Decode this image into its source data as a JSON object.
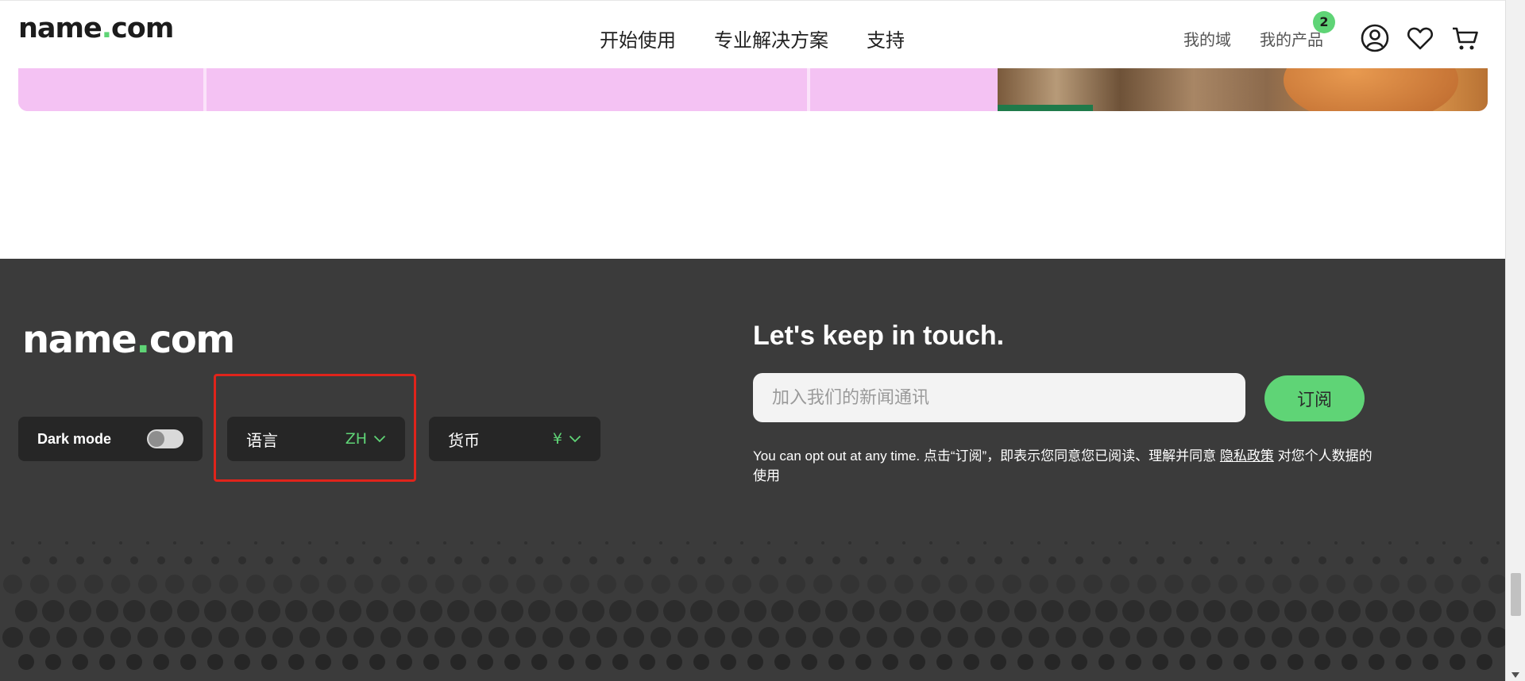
{
  "header": {
    "logo_main": "name",
    "logo_dot": ".",
    "logo_tld": "com",
    "nav": [
      "开始使用",
      "专业解决方案",
      "支持"
    ],
    "my_domains": "我的域",
    "my_products": "我的产品",
    "products_badge": "2",
    "icons": [
      "account-icon",
      "heart-icon",
      "cart-icon"
    ]
  },
  "footer": {
    "logo_main": "name",
    "logo_dot": ".",
    "logo_tld": "com",
    "dark_mode_label": "Dark mode",
    "dark_mode_on": false,
    "language_label": "语言",
    "language_value": "ZH",
    "currency_label": "货币",
    "currency_value": "¥",
    "newsletter_title": "Let's keep in touch.",
    "newsletter_placeholder": "加入我们的新闻通讯",
    "subscribe_label": "订阅",
    "legal_prefix": "You can opt out at any time. 点击“订阅”，即表示您同意您已阅读、理解并同意 ",
    "legal_link": "隐私政策",
    "legal_suffix": " 对您个人数据的使用"
  },
  "colors": {
    "brand_green": "#5fd476",
    "footer_bg": "#3b3b3b",
    "pill_bg": "#262626",
    "highlight_red": "#e0241b",
    "banner_pink": "#f4c2f3"
  }
}
